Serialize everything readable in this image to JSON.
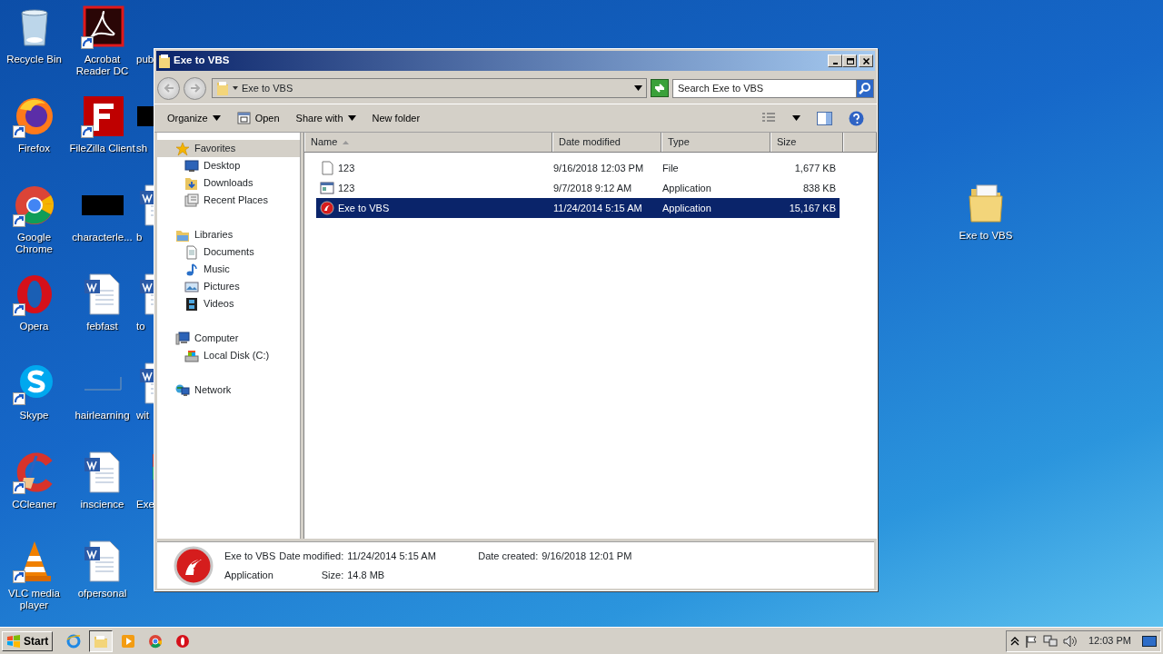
{
  "desktop": {
    "columns": [
      {
        "cut": false,
        "icons": [
          {
            "label": "Recycle Bin",
            "kind": "bin",
            "shortcut": false
          },
          {
            "label": "Firefox",
            "kind": "firefox",
            "shortcut": true
          },
          {
            "label": "Google Chrome",
            "kind": "chrome",
            "shortcut": true
          },
          {
            "label": "Opera",
            "kind": "opera",
            "shortcut": true
          },
          {
            "label": "Skype",
            "kind": "skype",
            "shortcut": true
          },
          {
            "label": "CCleaner",
            "kind": "ccleaner",
            "shortcut": true
          },
          {
            "label": "VLC media player",
            "kind": "vlc",
            "shortcut": true
          }
        ]
      },
      {
        "cut": false,
        "icons": [
          {
            "label": "Acrobat Reader DC",
            "kind": "acrobat",
            "shortcut": true
          },
          {
            "label": "FileZilla Client",
            "kind": "filezilla",
            "shortcut": true
          },
          {
            "label": "characterle...",
            "kind": "dark",
            "shortcut": false
          },
          {
            "label": "febfast",
            "kind": "document",
            "shortcut": false
          },
          {
            "label": "hairlearning",
            "kind": "line",
            "shortcut": false
          },
          {
            "label": "inscience",
            "kind": "document",
            "shortcut": false
          },
          {
            "label": "ofpersonal",
            "kind": "document",
            "shortcut": false
          }
        ]
      },
      {
        "cut": true,
        "icons": [
          {
            "label": "pub",
            "kind": "none",
            "shortcut": false
          },
          {
            "label": "sh",
            "kind": "dark",
            "shortcut": false
          },
          {
            "label": "b",
            "kind": "document",
            "shortcut": false
          },
          {
            "label": "to",
            "kind": "document",
            "shortcut": false
          },
          {
            "label": "wit",
            "kind": "document",
            "shortcut": false
          },
          {
            "label": "Exe",
            "kind": "colorful",
            "shortcut": false
          }
        ]
      }
    ],
    "extra": [
      {
        "label": "Exe to VBS",
        "kind": "folder",
        "shortcut": false
      }
    ]
  },
  "window": {
    "title": "Exe to VBS",
    "address": "Exe to VBS",
    "search": {
      "placeholder": "Search Exe to VBS"
    },
    "toolbar": [
      {
        "label": "Organize",
        "kind": "plain",
        "dropdown": true
      },
      {
        "label": "Open",
        "kind": "open",
        "dropdown": false
      },
      {
        "label": "Share with",
        "kind": "plain",
        "dropdown": true
      },
      {
        "label": "New folder",
        "kind": "plain",
        "dropdown": false
      }
    ],
    "navigation": [
      {
        "label": "Favorites",
        "kind": "star",
        "selected": true,
        "children": [
          {
            "label": "Desktop",
            "kind": "monitor",
            "selected": false
          },
          {
            "label": "Downloads",
            "kind": "downloads",
            "selected": false
          },
          {
            "label": "Recent Places",
            "kind": "recent",
            "selected": false
          }
        ]
      },
      {
        "label": "Libraries",
        "kind": "library",
        "selected": false,
        "children": [
          {
            "label": "Documents",
            "kind": "document",
            "selected": false
          },
          {
            "label": "Music",
            "kind": "music",
            "selected": false
          },
          {
            "label": "Pictures",
            "kind": "pictures",
            "selected": false
          },
          {
            "label": "Videos",
            "kind": "film",
            "selected": false
          }
        ]
      },
      {
        "label": "Computer",
        "kind": "computer",
        "selected": false,
        "children": [
          {
            "label": "Local Disk (C:)",
            "kind": "disk",
            "selected": false
          }
        ]
      },
      {
        "label": "Network",
        "kind": "network",
        "selected": false
      }
    ],
    "table": {
      "columns": [
        {
          "label": "Name",
          "sorted": true
        },
        {
          "label": "Date modified",
          "sorted": false
        },
        {
          "label": "Type",
          "sorted": false
        },
        {
          "label": "Size",
          "sorted": false
        }
      ],
      "rows": [
        {
          "kind": "blank",
          "selected": false,
          "cells": [
            "123",
            "9/16/2018 12:03 PM",
            "File",
            "1,677 KB"
          ]
        },
        {
          "kind": "window",
          "selected": false,
          "cells": [
            "123",
            "9/7/2018 9:12 AM",
            "Application",
            "838 KB"
          ]
        },
        {
          "kind": "red",
          "selected": true,
          "cells": [
            "Exe to VBS",
            "11/24/2014 5:15 AM",
            "Application",
            "15,167 KB"
          ]
        }
      ]
    },
    "details": {
      "kind": "red",
      "name": "Exe to VBS",
      "type": "Application",
      "fields": [
        {
          "label": "Date modified:",
          "value": "11/24/2014 5:15 AM"
        },
        {
          "label": "Size:",
          "value": "14.8 MB"
        },
        {
          "label": "Date created:",
          "value": "9/16/2018 12:01 PM"
        }
      ]
    }
  },
  "taskbar": {
    "start": "Start",
    "pinned": [
      {
        "kind": "ie",
        "active": false
      },
      {
        "kind": "folder",
        "active": true
      },
      {
        "kind": "media",
        "active": false
      },
      {
        "kind": "chrome",
        "active": false
      },
      {
        "kind": "opera",
        "active": false
      }
    ],
    "clock": "12:03 PM"
  }
}
